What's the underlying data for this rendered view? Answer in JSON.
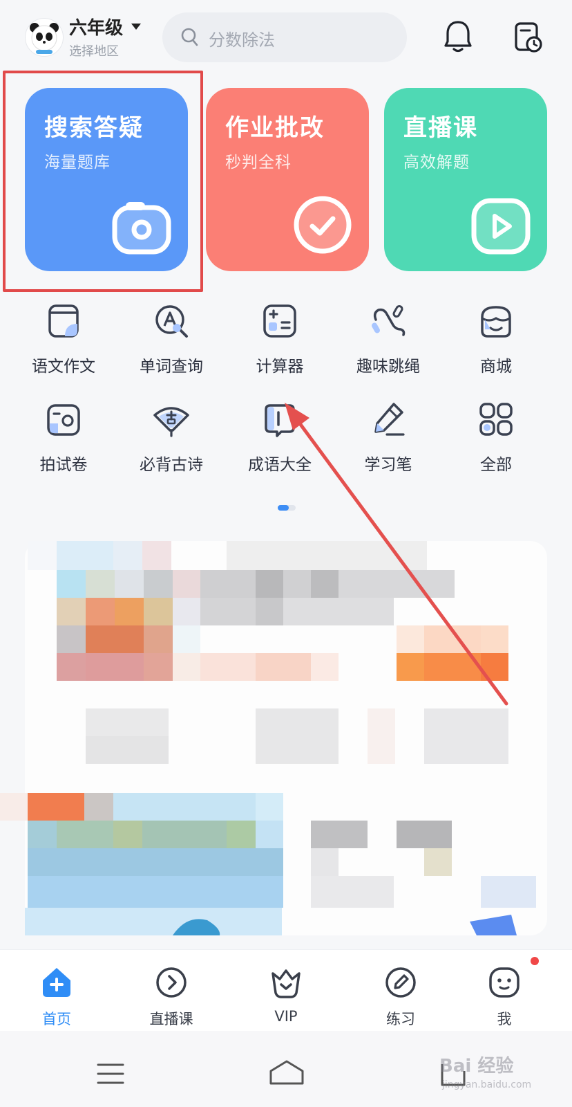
{
  "header": {
    "grade": "六年级",
    "region": "选择地区",
    "search_placeholder": "分数除法"
  },
  "feature_cards": [
    {
      "title": "搜索答疑",
      "subtitle": "海量题库",
      "icon": "camera-icon",
      "color": "#5a98f8"
    },
    {
      "title": "作业批改",
      "subtitle": "秒判全科",
      "icon": "check-circle-icon",
      "color": "#fb7f75"
    },
    {
      "title": "直播课",
      "subtitle": "高效解题",
      "icon": "play-icon",
      "color": "#4fd9b4"
    }
  ],
  "tools": [
    {
      "label": "语文作文",
      "icon": "notebook-icon"
    },
    {
      "label": "单词查询",
      "icon": "word-search-icon"
    },
    {
      "label": "计算器",
      "icon": "calculator-icon"
    },
    {
      "label": "趣味跳绳",
      "icon": "jump-rope-icon"
    },
    {
      "label": "商城",
      "icon": "shop-icon"
    },
    {
      "label": "拍试卷",
      "icon": "scan-paper-icon"
    },
    {
      "label": "必背古诗",
      "icon": "fan-poem-icon"
    },
    {
      "label": "成语大全",
      "icon": "idiom-book-icon"
    },
    {
      "label": "学习笔",
      "icon": "pen-icon"
    },
    {
      "label": "全部",
      "icon": "grid-icon"
    }
  ],
  "tabbar": [
    {
      "label": "首页",
      "icon": "home-plus-icon",
      "active": true
    },
    {
      "label": "直播课",
      "icon": "play-circle-icon",
      "active": false
    },
    {
      "label": "VIP",
      "icon": "vip-crown-icon",
      "active": false
    },
    {
      "label": "练习",
      "icon": "pencil-circle-icon",
      "active": false
    },
    {
      "label": "我",
      "icon": "face-icon",
      "active": false
    }
  ],
  "watermark": {
    "text": "Bai 经验",
    "url": "jingyan.baidu.com"
  },
  "colors": {
    "accent": "#2f8df6",
    "annotation": "#e14a4a"
  }
}
